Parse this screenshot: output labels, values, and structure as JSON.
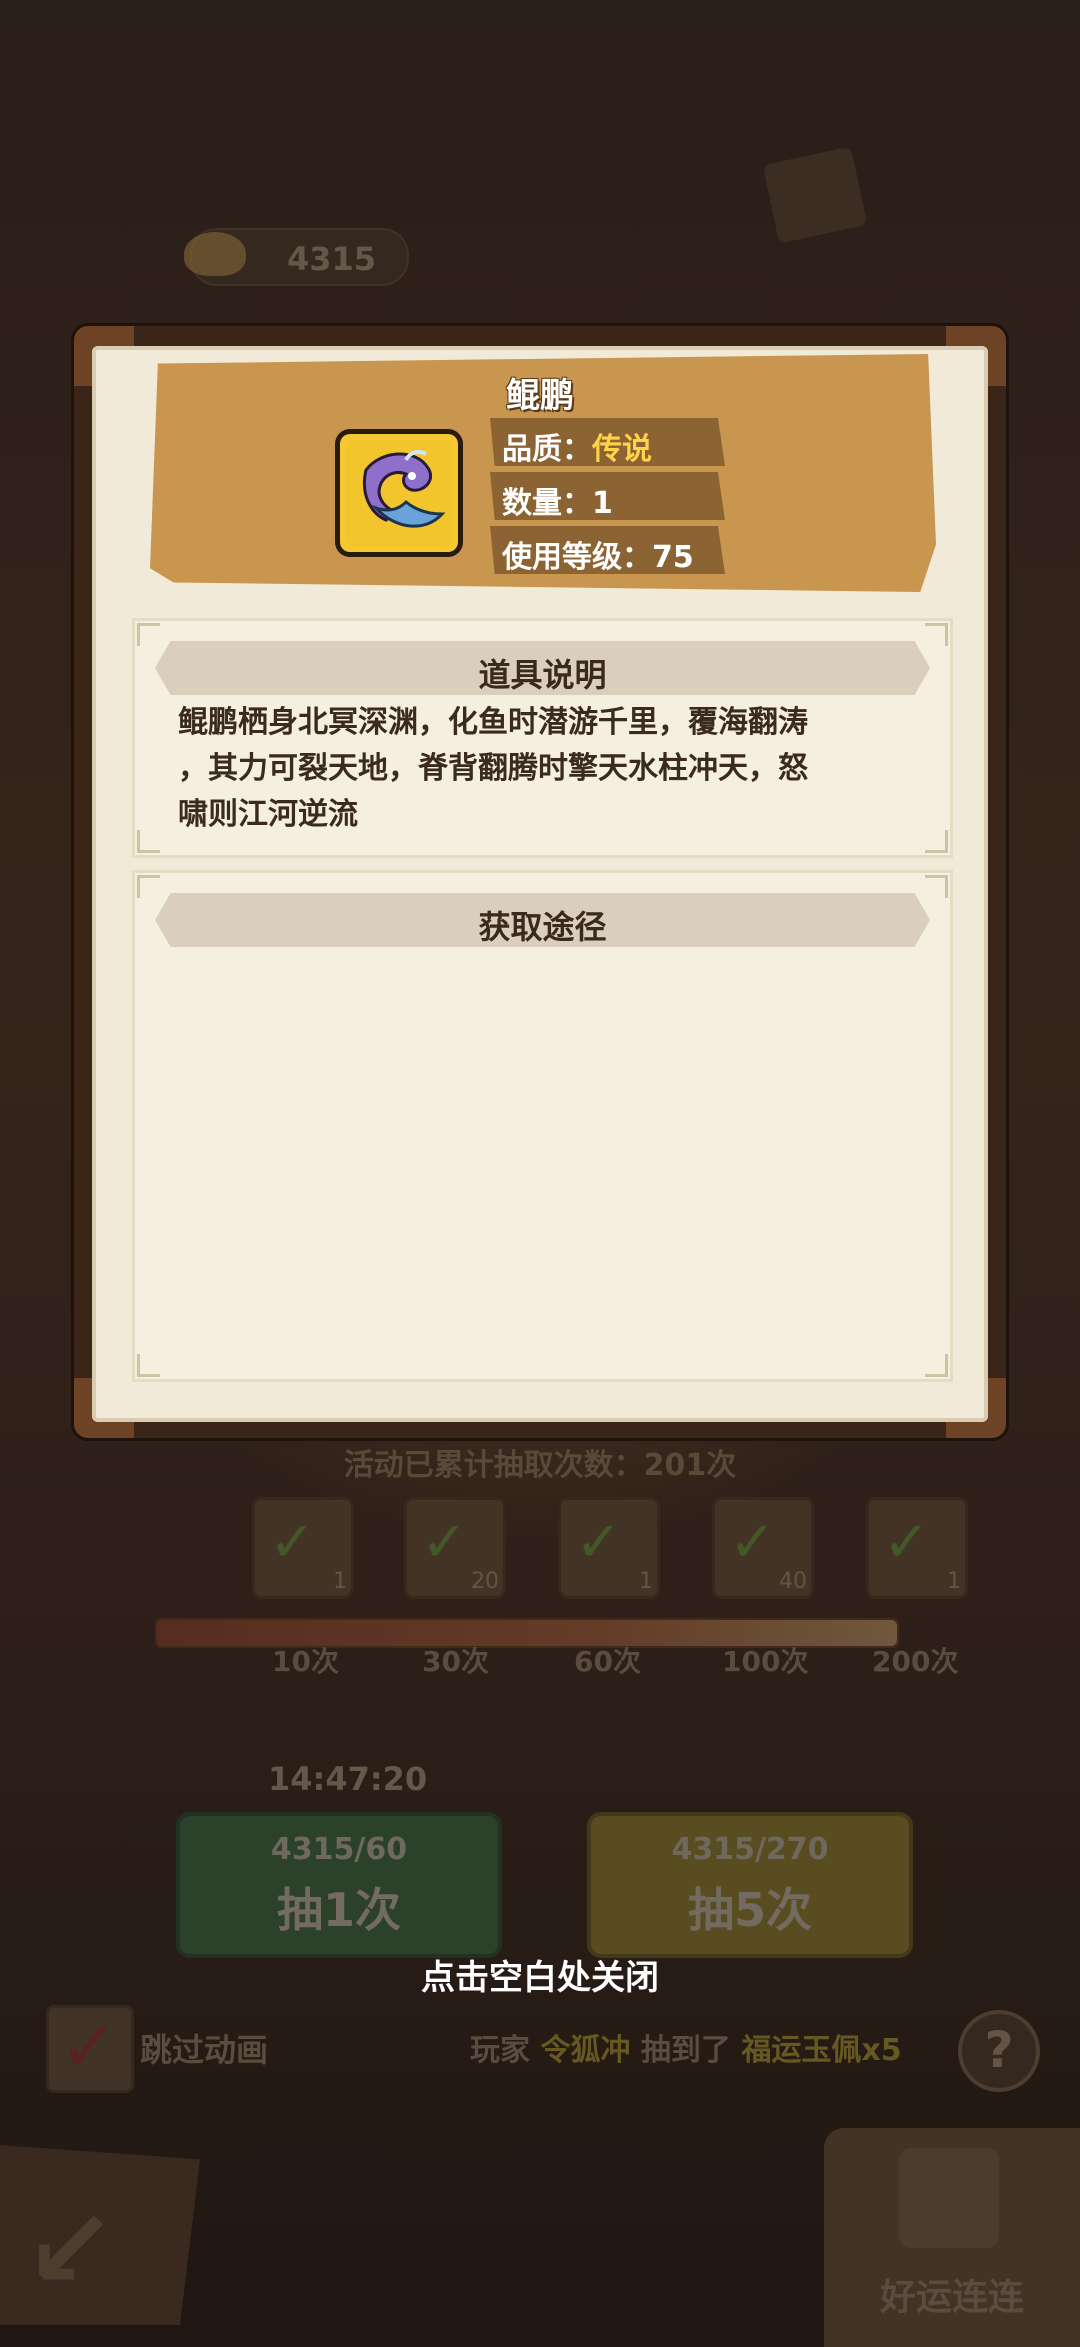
{
  "background": {
    "currency_value": "4315",
    "draw_counter": "活动已累计抽取次数：201次",
    "rewards": [
      {
        "count": "1"
      },
      {
        "count": "20"
      },
      {
        "count": "1"
      },
      {
        "count": "40"
      },
      {
        "count": "1"
      }
    ],
    "progress": 1.0,
    "milestones": [
      "10次",
      "30次",
      "60次",
      "100次",
      "200次"
    ],
    "timer": "14:47:20",
    "draw_one": {
      "cost": "4315/60",
      "label": "抽1次"
    },
    "draw_five": {
      "cost": "4315/270",
      "label": "抽5次"
    },
    "skip_label": "跳过动画",
    "ticker": {
      "prefix": "玩家",
      "player": "令狐冲",
      "middle": "抽到了",
      "item": "福运玉佩x5"
    },
    "help_label": "?",
    "lucky_label": "好运连连"
  },
  "modal": {
    "item_name": "鲲鹏",
    "quality_label": "品质：",
    "quality_value": "传说",
    "quantity": "数量：1",
    "use_level": "使用等级：75",
    "description_title": "道具说明",
    "description": "鲲鹏栖身北冥深渊，化鱼时潜游千里，覆海翻涛\n，其力可裂天地，脊背翻腾时擎天水柱冲天，怒\n啸则江河逆流",
    "source_title": "获取途径"
  },
  "close_hint": "点击空白处关闭",
  "colors": {
    "quality_legendary": "#ffd24a",
    "frame_dark": "#3b2418",
    "parchment": "#f1ead9",
    "title_band": "#c8964f"
  }
}
